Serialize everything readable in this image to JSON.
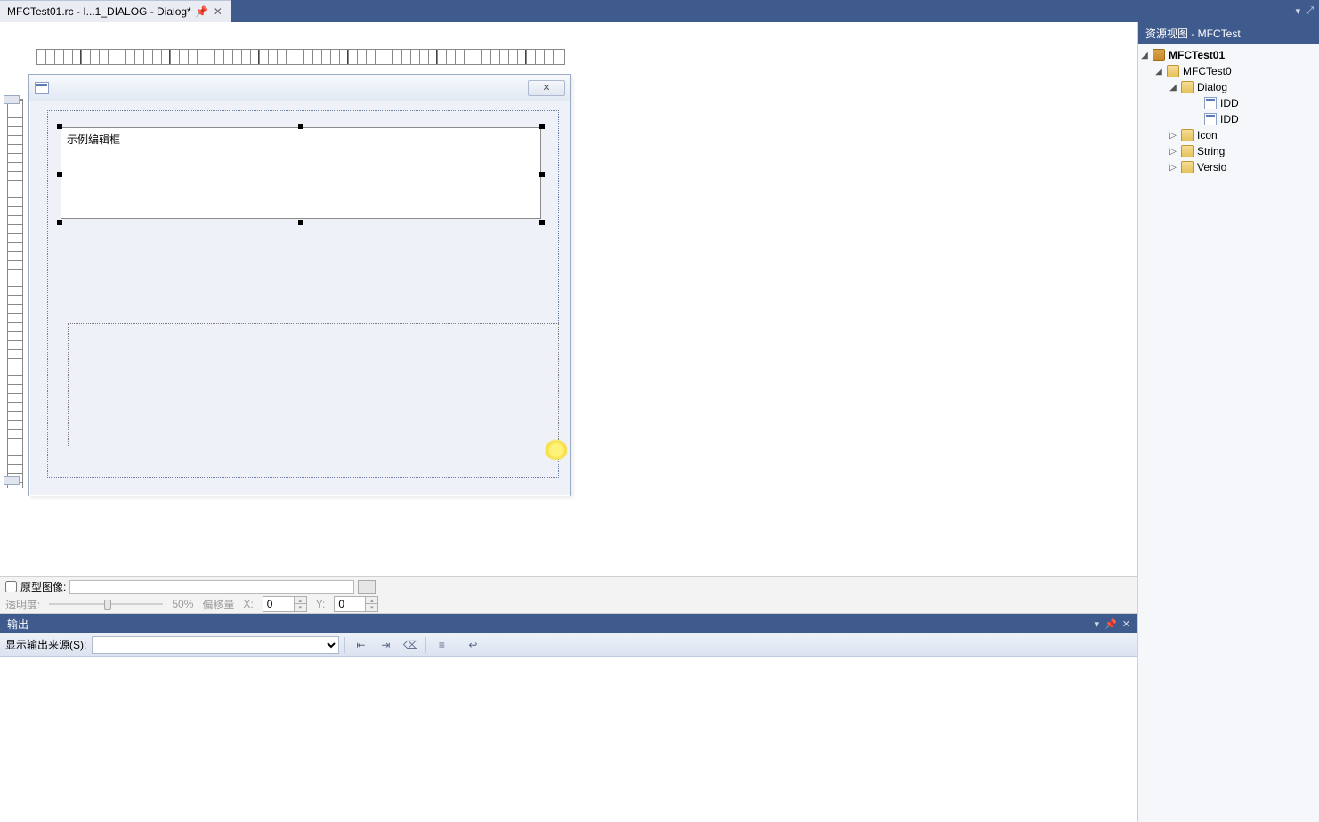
{
  "tab": {
    "label": "MFCTest01.rc - I...1_DIALOG - Dialog*"
  },
  "resource_view": {
    "title": "资源视图 - MFCTest",
    "root": "MFCTest01",
    "rc": "MFCTest0",
    "dialog_folder": "Dialog",
    "dlg1": "IDD",
    "dlg2": "IDD",
    "icon": "Icon",
    "string": "String",
    "version": "Versio"
  },
  "dialog": {
    "edit_text": "示例编辑框"
  },
  "proto": {
    "label": "原型图像:",
    "opacity_label": "透明度:",
    "opacity_value": "50%",
    "offset_label": "偏移量",
    "x_label": "X:",
    "y_label": "Y:",
    "x_value": "0",
    "y_value": "0"
  },
  "output": {
    "title": "输出",
    "source_label": "显示输出来源(S):"
  }
}
